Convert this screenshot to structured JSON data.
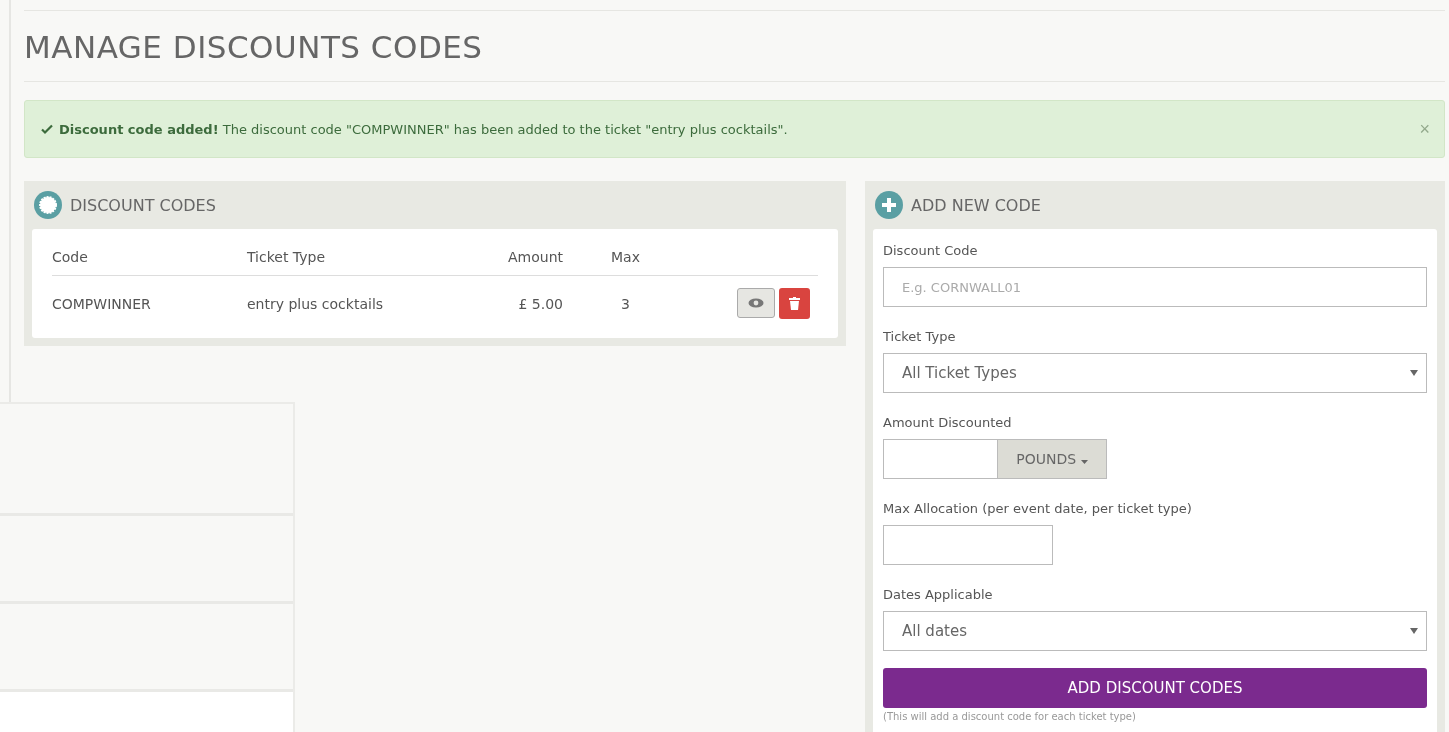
{
  "title": "MANAGE DISCOUNTS CODES",
  "alert": {
    "message": "**Discount code added!** The discount code \"COMPWINNER\" has been added to the ticket \"entry plus cocktails\".",
    "close": "×"
  },
  "discount_codes": {
    "title": "DISCOUNT CODES",
    "columns": [
      "Code",
      "Ticket Type",
      "Amount",
      "Max"
    ],
    "rows": [
      {
        "code": "COMPWINNER",
        "ticket_type": "entry plus cocktails",
        "amount": "£ 5.00",
        "max": "3"
      }
    ]
  },
  "add_new_code": {
    "title": "ADD NEW CODE",
    "fields": [
      {
        "kind": "text",
        "label": "Discount Code",
        "placeholder": "E.g. CORNWALL01"
      },
      {
        "kind": "select",
        "label": "Ticket Type",
        "value": "All Ticket Types"
      },
      {
        "kind": "amount",
        "label": "Amount Discounted",
        "unit": "POUNDS"
      },
      {
        "kind": "number",
        "label": "Max Allocation (per event date, per ticket type)"
      },
      {
        "kind": "select",
        "label": "Dates Applicable",
        "value": "All dates"
      }
    ],
    "button": "ADD DISCOUNT CODES",
    "note": "(This will add a discount code for each ticket type)"
  }
}
